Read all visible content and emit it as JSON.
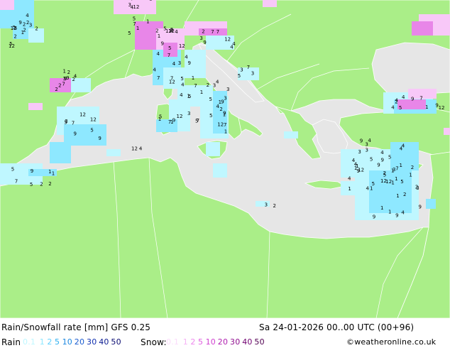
{
  "title": "Rain/Snowfall rate [mm] GFS 0.25",
  "datetime": "Sa 24-01-2026 00..00 UTC (00+96)",
  "rain_label": "Rain",
  "snow_label": "Snow:",
  "credit": "©weatheronline.co.uk",
  "rain_scale": [
    {
      "label": "0.1",
      "color": "#bff7ff"
    },
    {
      "label": "1",
      "color": "#8ee8ff"
    },
    {
      "label": "2",
      "color": "#5fd0ff"
    },
    {
      "label": "5",
      "color": "#2fb0f0"
    },
    {
      "label": "10",
      "color": "#1a86e0"
    },
    {
      "label": "20",
      "color": "#1a5cd0"
    },
    {
      "label": "30",
      "color": "#102fb0"
    },
    {
      "label": "40",
      "color": "#0a1a90"
    },
    {
      "label": "50",
      "color": "#080a70"
    }
  ],
  "snow_scale": [
    {
      "label": "0.1",
      "color": "#fbdcfb"
    },
    {
      "label": "1",
      "color": "#f6b4f6"
    },
    {
      "label": "2",
      "color": "#ee88ee"
    },
    {
      "label": "5",
      "color": "#e060e0"
    },
    {
      "label": "10",
      "color": "#d040d0"
    },
    {
      "label": "20",
      "color": "#b020b0"
    },
    {
      "label": "30",
      "color": "#901090"
    },
    {
      "label": "40",
      "color": "#700070"
    },
    {
      "label": "50",
      "color": "#500050"
    }
  ],
  "colors": {
    "land": "#aaee88",
    "sea": "#e6e6e6",
    "border": "#ffffff",
    "rain_light": "#bff7ff",
    "rain_medium": "#8ee8ff",
    "snow_light": "#f8c8f8",
    "snow_medium": "#e886e8"
  },
  "precip_markers": [
    "1",
    "2",
    "3",
    "4",
    "5",
    "7",
    "9",
    "12"
  ]
}
